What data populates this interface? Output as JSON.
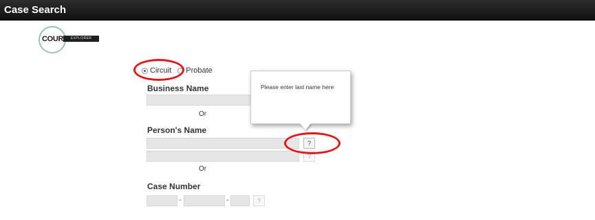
{
  "header": {
    "title": "Case Search"
  },
  "logo": {
    "word": "COURT",
    "tagline": "EXPLORER"
  },
  "court_type": {
    "options": [
      {
        "label": "Circuit",
        "selected": true
      },
      {
        "label": "Probate",
        "selected": false
      }
    ]
  },
  "business": {
    "label": "Business Name",
    "value": ""
  },
  "or_text": "Or",
  "person": {
    "label": "Person's Name",
    "last_name": "",
    "first_name": ""
  },
  "case_number": {
    "label": "Case Number",
    "part1": "",
    "part2": "",
    "part3": ""
  },
  "help": {
    "button": "?"
  },
  "tooltip": {
    "text": "Please enter last name here"
  },
  "colors": {
    "annotation": "#e01818",
    "header": "#1a1a1a"
  }
}
